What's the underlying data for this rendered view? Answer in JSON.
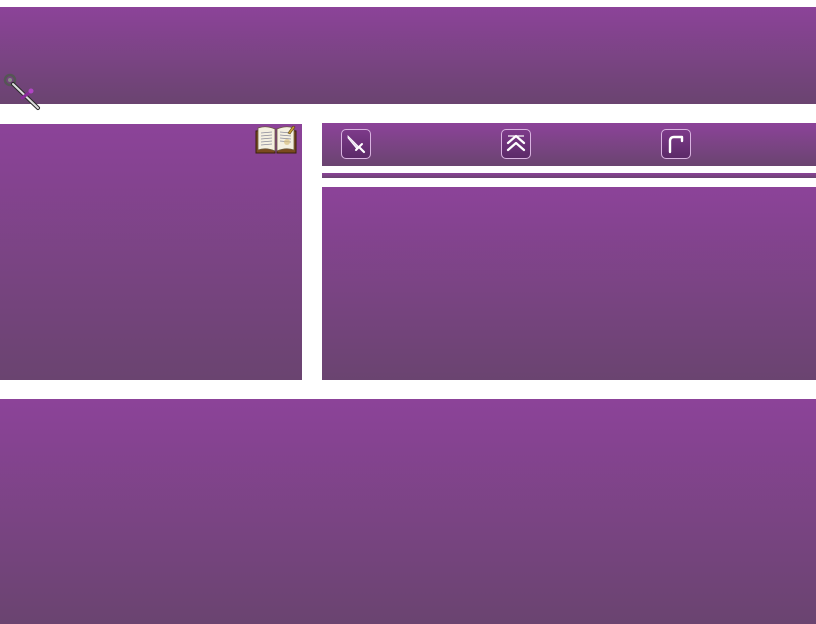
{
  "screen": {
    "background": "#ffffff",
    "panel_gradient_top": "#8c4399",
    "panel_gradient_bottom": "#6a4470"
  },
  "top_panel": {
    "icon": "staff-icon"
  },
  "left_panel": {
    "icon": "spellbook-icon"
  },
  "toolbar": {
    "buttons": [
      {
        "name": "sword",
        "icon": "sword-icon"
      },
      {
        "name": "ascend",
        "icon": "double-chevron-up-icon"
      },
      {
        "name": "return",
        "icon": "return-arrow-icon"
      }
    ]
  }
}
